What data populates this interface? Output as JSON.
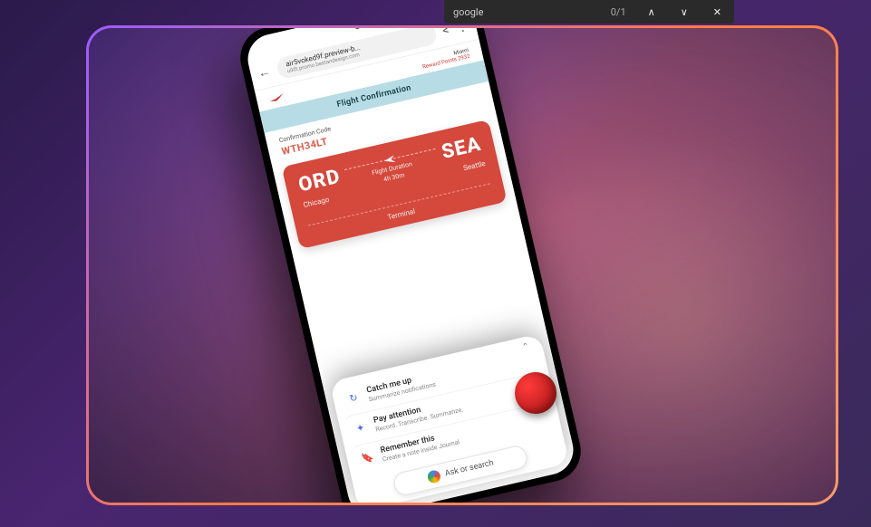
{
  "find_bar": {
    "query": "google",
    "count": "0/1",
    "prev": "∧",
    "next": "∨",
    "close": "✕"
  },
  "status": {
    "signal": "▴",
    "battery": "▮"
  },
  "browser": {
    "back": "←",
    "lock": "🔒",
    "url_main": "air5voked9f.preview-b...",
    "url_sub": "uilift.promo.bestandesign.com",
    "share": "<",
    "menu": "⋮"
  },
  "airline": {
    "brand_name": "",
    "member_label": "Miami",
    "member_points": "Reward Points 2932"
  },
  "banner": {
    "text": "Flight Confirmation"
  },
  "confirmation": {
    "label": "Confirmation Code",
    "code": "WTH34LT"
  },
  "flight": {
    "origin_code": "ORD",
    "origin_city": "Chicago",
    "dest_code": "SEA",
    "dest_city": "Seattle",
    "duration_label": "Flight Duration",
    "duration_value": "4h 30m",
    "terminal_label": "Terminal"
  },
  "assistant": {
    "caret": "⌃",
    "rows": [
      {
        "icon": "↻",
        "title": "Catch me up",
        "subtitle": "Summarize notifications"
      },
      {
        "icon": "✦",
        "title": "Pay attention",
        "subtitle": "Record. Transcribe. Summarize."
      },
      {
        "icon": "🔖",
        "title": "Remember this",
        "subtitle": "Create a note inside Journal"
      }
    ],
    "pill_label": "Ask or search"
  }
}
